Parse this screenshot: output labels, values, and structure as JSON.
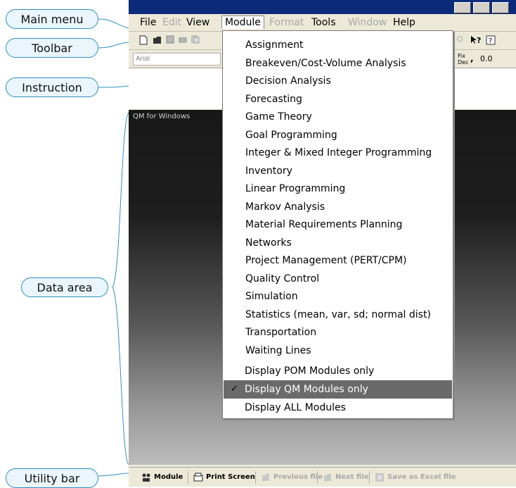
{
  "callouts": {
    "main_menu": "Main menu",
    "toolbar": "Toolbar",
    "instruction": "Instruction",
    "data_area": "Data area",
    "utility_bar": "Utility bar"
  },
  "menubar": {
    "items": [
      "File",
      "Edit",
      "View",
      "Module",
      "Format",
      "Tools",
      "Window",
      "Help"
    ]
  },
  "toolbar": {
    "font_name": "Arial",
    "fix_dec_label": "Fix Dec",
    "decimal_value": "0.0"
  },
  "data_area": {
    "window_title": "QM for Windows"
  },
  "module_menu": {
    "modules": [
      "Assignment",
      "Breakeven/Cost-Volume Analysis",
      "Decision Analysis",
      "Forecasting",
      "Game Theory",
      "Goal Programming",
      "Integer & Mixed Integer Programming",
      "Inventory",
      "Linear Programming",
      "Markov Analysis",
      "Material Requirements Planning",
      "Networks",
      "Project Management (PERT/CPM)",
      "Quality Control",
      "Simulation",
      "Statistics (mean, var, sd; normal dist)",
      "Transportation",
      "Waiting Lines"
    ],
    "display_options": [
      "Display POM Modules only",
      "Display QM Modules only",
      "Display ALL Modules"
    ],
    "selected_option": "Display QM Modules only"
  },
  "utility_bar": {
    "module": "Module",
    "print_screen": "Print Screen",
    "previous_file": "Previous file",
    "next_file": "Next file",
    "save_as_excel": "Save as Excel file"
  }
}
